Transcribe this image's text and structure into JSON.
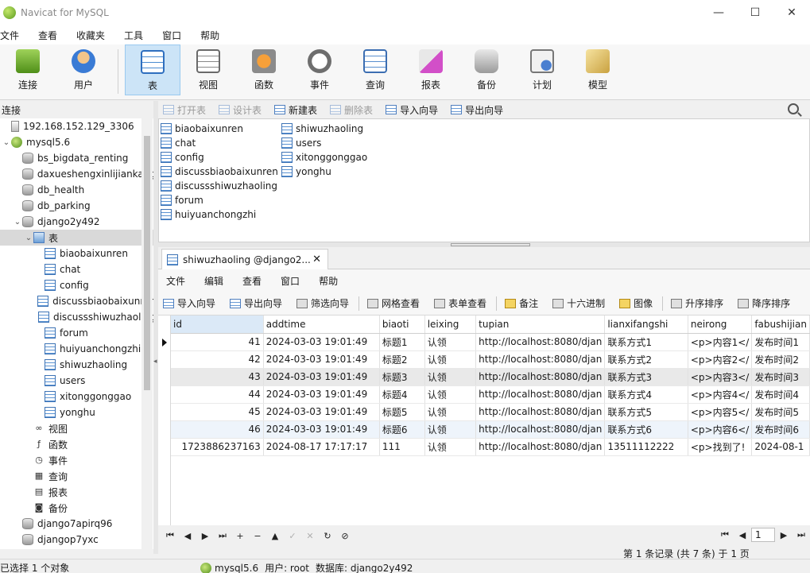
{
  "window": {
    "title": "Navicat for MySQL",
    "minimize": "—",
    "maximize": "☐",
    "close": "✕"
  },
  "menubar": [
    "文件",
    "查看",
    "收藏夹",
    "工具",
    "窗口",
    "帮助"
  ],
  "toolbar": [
    {
      "label": "连接",
      "icon": "connection-icon"
    },
    {
      "label": "用户",
      "icon": "user-icon"
    },
    {
      "label": "表",
      "icon": "table-icon",
      "active": true
    },
    {
      "label": "视图",
      "icon": "view-icon"
    },
    {
      "label": "函数",
      "icon": "function-icon"
    },
    {
      "label": "事件",
      "icon": "event-icon"
    },
    {
      "label": "查询",
      "icon": "query-icon"
    },
    {
      "label": "报表",
      "icon": "report-icon"
    },
    {
      "label": "备份",
      "icon": "backup-icon"
    },
    {
      "label": "计划",
      "icon": "schedule-icon"
    },
    {
      "label": "模型",
      "icon": "model-icon"
    }
  ],
  "left_panel": {
    "header": "连接",
    "tree": [
      {
        "label": "192.168.152.129_3306",
        "icon": "server-icon",
        "level": 0
      },
      {
        "label": "mysql5.6",
        "icon": "mysql-icon",
        "level": 0,
        "twisty": "⌄"
      },
      {
        "label": "bs_bigdata_renting",
        "icon": "database-icon",
        "level": 1
      },
      {
        "label": "daxueshengxinlijiankang",
        "icon": "database-icon",
        "level": 1
      },
      {
        "label": "db_health",
        "icon": "database-icon",
        "level": 1
      },
      {
        "label": "db_parking",
        "icon": "database-icon",
        "level": 1
      },
      {
        "label": "django2y492",
        "icon": "database-icon",
        "level": 1,
        "twisty": "⌄"
      },
      {
        "label": "表",
        "icon": "folder-table-icon",
        "level": 2,
        "twisty": "⌄",
        "selected": true
      },
      {
        "label": "biaobaixunren",
        "icon": "table-icon",
        "level": 3
      },
      {
        "label": "chat",
        "icon": "table-icon",
        "level": 3
      },
      {
        "label": "config",
        "icon": "table-icon",
        "level": 3
      },
      {
        "label": "discussbiaobaixunren",
        "icon": "table-icon",
        "level": 3
      },
      {
        "label": "discussshiwuzhaoling",
        "icon": "table-icon",
        "level": 3
      },
      {
        "label": "forum",
        "icon": "table-icon",
        "level": 3
      },
      {
        "label": "huiyuanchongzhi",
        "icon": "table-icon",
        "level": 3
      },
      {
        "label": "shiwuzhaoling",
        "icon": "table-icon",
        "level": 3
      },
      {
        "label": "users",
        "icon": "table-icon",
        "level": 3
      },
      {
        "label": "xitonggonggao",
        "icon": "table-icon",
        "level": 3
      },
      {
        "label": "yonghu",
        "icon": "table-icon",
        "level": 3
      },
      {
        "label": "视图",
        "icon": "view-icon",
        "level": 2
      },
      {
        "label": "函数",
        "icon": "function-icon",
        "level": 2
      },
      {
        "label": "事件",
        "icon": "event-icon",
        "level": 2
      },
      {
        "label": "查询",
        "icon": "query-icon",
        "level": 2
      },
      {
        "label": "报表",
        "icon": "report-icon",
        "level": 2
      },
      {
        "label": "备份",
        "icon": "backup-icon",
        "level": 2
      },
      {
        "label": "django7apirq96",
        "icon": "database-icon",
        "level": 1
      },
      {
        "label": "djangop7yxc",
        "icon": "database-icon",
        "level": 1
      }
    ]
  },
  "object_toolbar": [
    {
      "label": "打开表",
      "disabled": true
    },
    {
      "label": "设计表",
      "disabled": true
    },
    {
      "label": "新建表",
      "disabled": false
    },
    {
      "label": "删除表",
      "disabled": true
    },
    {
      "label": "导入向导",
      "disabled": false
    },
    {
      "label": "导出向导",
      "disabled": false
    }
  ],
  "object_list": {
    "col1": [
      "biaobaixunren",
      "chat",
      "config",
      "discussbiaobaixunren",
      "discussshiwuzhaoling",
      "forum",
      "huiyuanchongzhi"
    ],
    "col2": [
      "shiwuzhaoling",
      "users",
      "xitonggonggao",
      "yonghu"
    ]
  },
  "tab": {
    "label": "shiwuzhaoling @django2...",
    "close": "✕"
  },
  "inner_menu": [
    "文件",
    "编辑",
    "查看",
    "窗口",
    "帮助"
  ],
  "inner_toolbar": [
    {
      "label": "导入向导",
      "icon": "import-icon"
    },
    {
      "label": "导出向导",
      "icon": "export-icon"
    },
    {
      "label": "筛选向导",
      "icon": "filter-icon"
    },
    {
      "label": "网格查看",
      "icon": "grid-view-icon"
    },
    {
      "label": "表单查看",
      "icon": "form-view-icon"
    },
    {
      "label": "备注",
      "icon": "memo-icon"
    },
    {
      "label": "十六进制",
      "icon": "hex-icon"
    },
    {
      "label": "图像",
      "icon": "image-icon"
    },
    {
      "label": "升序排序",
      "icon": "sort-asc-icon"
    },
    {
      "label": "降序排序",
      "icon": "sort-desc-icon"
    }
  ],
  "grid": {
    "columns": [
      "id",
      "addtime",
      "biaoti",
      "leixing",
      "tupian",
      "lianxifangshi",
      "neirong",
      "fabushijian"
    ],
    "rows": [
      [
        "41",
        "2024-03-03 19:01:49",
        "标题1",
        "认领",
        "http://localhost:8080/djan",
        "联系方式1",
        "<p>内容1</",
        "发布时间1"
      ],
      [
        "42",
        "2024-03-03 19:01:49",
        "标题2",
        "认领",
        "http://localhost:8080/djan",
        "联系方式2",
        "<p>内容2</",
        "发布时间2"
      ],
      [
        "43",
        "2024-03-03 19:01:49",
        "标题3",
        "认领",
        "http://localhost:8080/djan",
        "联系方式3",
        "<p>内容3</",
        "发布时间3"
      ],
      [
        "44",
        "2024-03-03 19:01:49",
        "标题4",
        "认领",
        "http://localhost:8080/djan",
        "联系方式4",
        "<p>内容4</",
        "发布时间4"
      ],
      [
        "45",
        "2024-03-03 19:01:49",
        "标题5",
        "认领",
        "http://localhost:8080/djan",
        "联系方式5",
        "<p>内容5</",
        "发布时间5"
      ],
      [
        "46",
        "2024-03-03 19:01:49",
        "标题6",
        "认领",
        "http://localhost:8080/djan",
        "联系方式6",
        "<p>内容6</",
        "发布时间6"
      ],
      [
        "1723886237163",
        "2024-08-17 17:17:17",
        "111",
        "认领",
        "http://localhost:8080/djan",
        "13511112222",
        "<p>找到了!",
        "2024-08-1"
      ]
    ]
  },
  "navbar": {
    "buttons": [
      "⏮",
      "◀",
      "▶",
      "⏭",
      "+",
      "−",
      "▲",
      "✓",
      "✕",
      "↻",
      "⊘"
    ],
    "page": "1"
  },
  "record_info": "第 1 条记录 (共 7 条) 于 1 页",
  "statusbar": {
    "left": "已选择 1 个对象",
    "connection": "mysql5.6",
    "user": "用户: root",
    "database": "数据库: django2y492"
  }
}
